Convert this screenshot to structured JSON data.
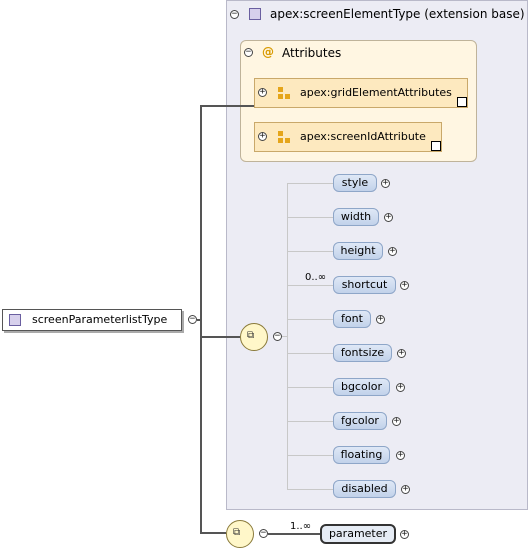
{
  "diagram": {
    "root_type": {
      "label": "screenParameterlistType"
    },
    "extension": {
      "label": "apex:screenElementType (extension base)"
    },
    "attributes": {
      "label": "Attributes",
      "items": [
        {
          "label": "apex:gridElementAttributes"
        },
        {
          "label": "apex:screenIdAttribute"
        }
      ]
    },
    "sequence_1": {
      "multiplicity": "0..∞",
      "elements": [
        "style",
        "width",
        "height",
        "shortcut",
        "font",
        "fontsize",
        "bgcolor",
        "fgcolor",
        "floating",
        "disabled"
      ]
    },
    "sequence_2": {
      "multiplicity": "1..∞",
      "element": "parameter"
    }
  }
}
